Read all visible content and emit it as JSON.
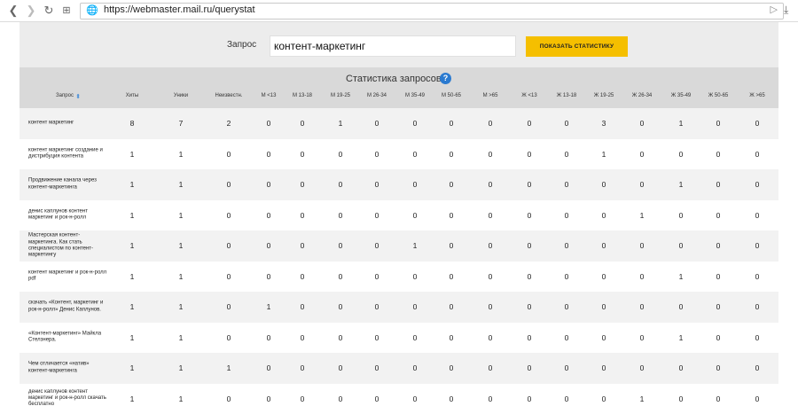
{
  "browser": {
    "url": "https://webmaster.mail.ru/querystat",
    "back_icon": "back-arrow-icon",
    "forward_icon": "forward-arrow-icon",
    "reload_icon": "reload-icon",
    "tabs_icon": "tabs-grid-icon",
    "site_icon": "globe-icon",
    "send_icon": "send-icon",
    "download_icon": "download-icon"
  },
  "query": {
    "label": "Запрос",
    "value": "контент-маркетинг",
    "button_label": "ПОКАЗАТЬ СТАТИСТИКУ",
    "button_color": "#f5bf00"
  },
  "stats": {
    "title": "Статистика запросов",
    "help": "?",
    "columns": [
      "Запрос",
      "Хиты",
      "Уники",
      "Неизвестн.",
      "М <13",
      "М 13-18",
      "М 19-25",
      "М 26-34",
      "М 35-49",
      "М 50-65",
      "М >65",
      "Ж <13",
      "Ж 13-18",
      "Ж 19-25",
      "Ж 26-34",
      "Ж 35-49",
      "Ж 50-65",
      "Ж >65"
    ],
    "rows": [
      {
        "query": "контент маркетинг",
        "values": [
          "8",
          "7",
          "2",
          "0",
          "0",
          "1",
          "0",
          "0",
          "0",
          "0",
          "0",
          "0",
          "3",
          "0",
          "1",
          "0",
          "0"
        ]
      },
      {
        "query": "контент маркетинг создание и дистрибуция контента",
        "values": [
          "1",
          "1",
          "0",
          "0",
          "0",
          "0",
          "0",
          "0",
          "0",
          "0",
          "0",
          "0",
          "1",
          "0",
          "0",
          "0",
          "0"
        ]
      },
      {
        "query": "Продвижение канала через контент-маркетинга",
        "values": [
          "1",
          "1",
          "0",
          "0",
          "0",
          "0",
          "0",
          "0",
          "0",
          "0",
          "0",
          "0",
          "0",
          "0",
          "1",
          "0",
          "0"
        ]
      },
      {
        "query": "денис каплунов контент маркетинг и рок-н-ролл",
        "values": [
          "1",
          "1",
          "0",
          "0",
          "0",
          "0",
          "0",
          "0",
          "0",
          "0",
          "0",
          "0",
          "0",
          "1",
          "0",
          "0",
          "0"
        ]
      },
      {
        "query": "Мастерская контент-маркетинга. Как стать специалистом по контент-маркетингу",
        "values": [
          "1",
          "1",
          "0",
          "0",
          "0",
          "0",
          "0",
          "1",
          "0",
          "0",
          "0",
          "0",
          "0",
          "0",
          "0",
          "0",
          "0"
        ]
      },
      {
        "query": "контент маркетинг и рок-н-ролл pdf",
        "values": [
          "1",
          "1",
          "0",
          "0",
          "0",
          "0",
          "0",
          "0",
          "0",
          "0",
          "0",
          "0",
          "0",
          "0",
          "1",
          "0",
          "0"
        ]
      },
      {
        "query": "скачать «Контент, маркетинг и рок-н-ролл» Денис Каплунов.",
        "values": [
          "1",
          "1",
          "0",
          "1",
          "0",
          "0",
          "0",
          "0",
          "0",
          "0",
          "0",
          "0",
          "0",
          "0",
          "0",
          "0",
          "0"
        ]
      },
      {
        "query": "«Контент-маркетинг» Майкла Стелзнера.",
        "values": [
          "1",
          "1",
          "0",
          "0",
          "0",
          "0",
          "0",
          "0",
          "0",
          "0",
          "0",
          "0",
          "0",
          "0",
          "1",
          "0",
          "0"
        ]
      },
      {
        "query": "Чем отличается «натив» контент-маркетинга",
        "values": [
          "1",
          "1",
          "1",
          "0",
          "0",
          "0",
          "0",
          "0",
          "0",
          "0",
          "0",
          "0",
          "0",
          "0",
          "0",
          "0",
          "0"
        ]
      },
      {
        "query": "денис каплунов контент маркетинг и рок-н-ролл скачать бесплатно",
        "values": [
          "1",
          "1",
          "0",
          "0",
          "0",
          "0",
          "0",
          "0",
          "0",
          "0",
          "0",
          "0",
          "0",
          "1",
          "0",
          "0",
          "0"
        ]
      }
    ]
  }
}
